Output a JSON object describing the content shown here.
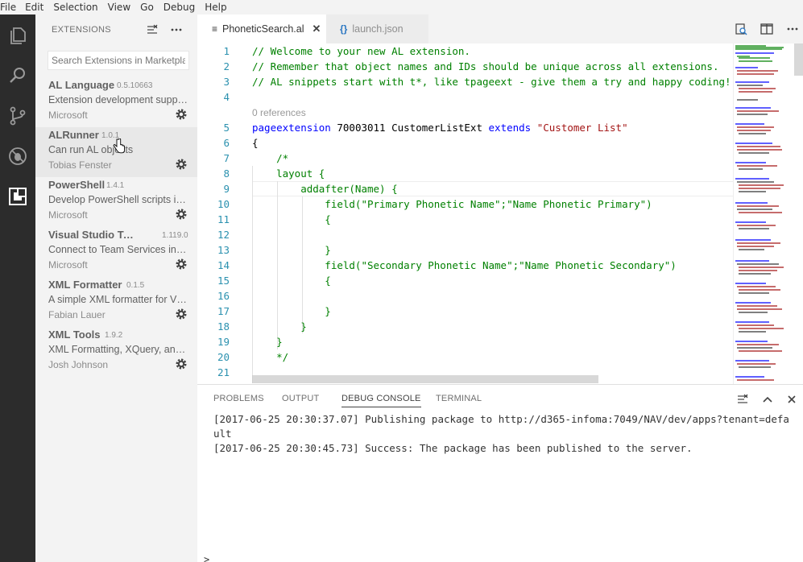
{
  "menu": [
    {
      "label": "File"
    },
    {
      "label": "Edit"
    },
    {
      "label": "Selection"
    },
    {
      "label": "View"
    },
    {
      "label": "Go"
    },
    {
      "label": "Debug"
    },
    {
      "label": "Help"
    }
  ],
  "sidebar": {
    "title": "EXTENSIONS",
    "search_placeholder": "Search Extensions in Marketplace",
    "extensions": [
      {
        "name": "AL Language",
        "version": "0.5.10663",
        "description": "Extension development support for Microsoft Dynamics NAV",
        "author": "Microsoft"
      },
      {
        "name": "ALRunner",
        "version": "1.0.1",
        "description": "Can run AL objects",
        "author": "Tobias Fenster"
      },
      {
        "name": "PowerShell",
        "version": "1.4.1",
        "description": "Develop PowerShell scripts in Visual Studio Code",
        "author": "Microsoft"
      },
      {
        "name": "Visual Studio Team S..",
        "version": "1.119.0",
        "description": "Connect to Team Services including Team Foundation",
        "author": "Microsoft"
      },
      {
        "name": "XML Formatter",
        "version": "0.1.5",
        "description": "A simple XML formatter for VS Code",
        "author": "Fabian Lauer"
      },
      {
        "name": "XML Tools",
        "version": "1.9.2",
        "description": "XML Formatting, XQuery, and XPath Tools",
        "author": "Josh Johnson"
      }
    ]
  },
  "tabs": [
    {
      "label": "PhoneticSearch.al",
      "active": true
    },
    {
      "label": "launch.json",
      "active": false
    }
  ],
  "editor": {
    "codelens": "0 references",
    "lines": [
      {
        "n": "1",
        "text": "// Welcome to your new AL extension."
      },
      {
        "n": "2",
        "text": "// Remember that object names and IDs should be unique across all extensions."
      },
      {
        "n": "3",
        "text": "// AL snippets start with t*, like tpageext - give them a try and happy coding!"
      },
      {
        "n": "4",
        "text": ""
      },
      {
        "n": "5",
        "kw1": "pageextension",
        "mid1": " 70003011 CustomerListExt ",
        "kw2": "extends",
        "str": " \"Customer List\""
      },
      {
        "n": "6",
        "text": "{"
      },
      {
        "n": "7",
        "text": "    /*"
      },
      {
        "n": "8",
        "text": "    layout {"
      },
      {
        "n": "9",
        "text": "        addafter(Name) {"
      },
      {
        "n": "10",
        "text": "            field(\"Primary Phonetic Name\";\"Name Phonetic Primary\")"
      },
      {
        "n": "11",
        "text": "            {"
      },
      {
        "n": "12",
        "text": ""
      },
      {
        "n": "13",
        "text": "            }"
      },
      {
        "n": "14",
        "text": "            field(\"Secondary Phonetic Name\";\"Name Phonetic Secondary\")"
      },
      {
        "n": "15",
        "text": "            {"
      },
      {
        "n": "16",
        "text": ""
      },
      {
        "n": "17",
        "text": "            }"
      },
      {
        "n": "18",
        "text": "        }"
      },
      {
        "n": "19",
        "text": "    }"
      },
      {
        "n": "20",
        "text": "    */"
      },
      {
        "n": "21",
        "text": ""
      }
    ]
  },
  "panel": {
    "tabs": [
      "PROBLEMS",
      "OUTPUT",
      "DEBUG CONSOLE",
      "TERMINAL"
    ],
    "active_tab": "DEBUG CONSOLE",
    "console": [
      "[2017-06-25 20:30:37.07] Publishing package to http://d365-infoma:7049/NAV/dev/apps?tenant=defa",
      "ult",
      "[2017-06-25 20:30:45.73] Success: The package has been published to the server."
    ],
    "prompt": ">"
  },
  "colors": {
    "activity_bar": "#2c2c2c",
    "sidebar": "#f3f3f3",
    "comment": "#008000",
    "keyword": "#0000ff",
    "string": "#a31515",
    "line_number": "#2b91af"
  }
}
